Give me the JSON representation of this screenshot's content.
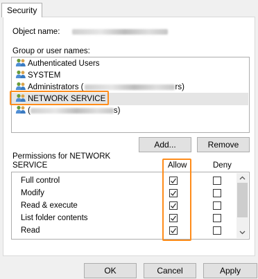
{
  "tab": "Security",
  "object_name_label": "Object name:",
  "group_label": "Group or user names:",
  "users": [
    {
      "label": "Authenticated Users",
      "suffix": ""
    },
    {
      "label": "SYSTEM",
      "suffix": ""
    },
    {
      "label": "Administrators (",
      "suffix": "rs)"
    },
    {
      "label": "NETWORK SERVICE",
      "suffix": ""
    },
    {
      "label": "",
      "suffix": "s)"
    }
  ],
  "buttons": {
    "add": "Add...",
    "remove": "Remove",
    "ok": "OK",
    "cancel": "Cancel",
    "apply": "Apply"
  },
  "permissions": {
    "header_line1": "Permissions for NETWORK",
    "header_line2": "SERVICE",
    "allow": "Allow",
    "deny": "Deny",
    "rows": [
      {
        "name": "Full control",
        "allow": true,
        "deny": false
      },
      {
        "name": "Modify",
        "allow": true,
        "deny": false
      },
      {
        "name": "Read & execute",
        "allow": true,
        "deny": false
      },
      {
        "name": "List folder contents",
        "allow": true,
        "deny": false
      },
      {
        "name": "Read",
        "allow": true,
        "deny": false
      }
    ]
  },
  "colors": {
    "highlight": "#ff8c1a",
    "selection": "#e5e5e5"
  }
}
